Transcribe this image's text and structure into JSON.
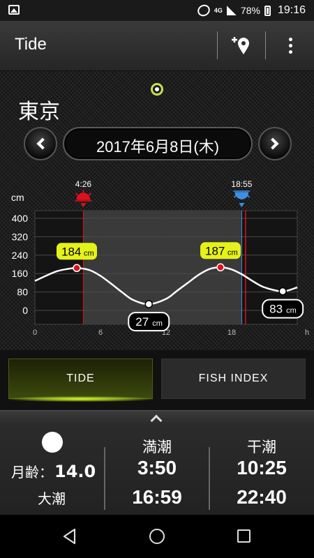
{
  "status_bar": {
    "network": "4G",
    "battery": "78%",
    "time": "19:16"
  },
  "app_bar": {
    "title": "Tide",
    "icons": [
      "add-location-icon",
      "overflow-menu-icon"
    ]
  },
  "location": "東京",
  "date": "2017年6月8日(木)",
  "chart_data": {
    "type": "line",
    "y_unit": "cm",
    "x_unit": "h",
    "xlim": [
      0,
      24
    ],
    "ylim": [
      0,
      400
    ],
    "x_ticks": [
      "0",
      "6",
      "12",
      "18"
    ],
    "y_ticks": [
      "400",
      "320",
      "240",
      "160",
      "80",
      "0"
    ],
    "sunrise": "4:26",
    "sunset": "18:55",
    "sunrise_hour": 4.43,
    "sunset_hour": 18.92,
    "current_time_hour": 19.27,
    "series": [
      {
        "values_x": [
          0,
          1,
          2,
          3,
          3.83,
          5,
          6,
          7,
          8,
          9,
          10.42,
          12,
          13,
          14,
          15,
          16,
          16.98,
          18,
          19,
          20,
          21,
          22.67,
          24
        ],
        "values_y": [
          128,
          150,
          170,
          180,
          184,
          175,
          150,
          115,
          78,
          45,
          27,
          50,
          85,
          120,
          155,
          180,
          187,
          178,
          155,
          125,
          100,
          83,
          100
        ]
      }
    ],
    "annotations": [
      {
        "label": "184",
        "unit": "cm",
        "x": 3.83,
        "y": 184,
        "kind": "high"
      },
      {
        "label": "27",
        "unit": "cm",
        "x": 10.42,
        "y": 27,
        "kind": "low"
      },
      {
        "label": "187",
        "unit": "cm",
        "x": 16.98,
        "y": 187,
        "kind": "high"
      },
      {
        "label": "83",
        "unit": "cm",
        "x": 22.67,
        "y": 83,
        "kind": "low"
      }
    ],
    "colors": {
      "high_badge": "#e5f21a",
      "high_point": "#e0101a",
      "sunrise": "#e0101a",
      "sunset": "#3f8fe0",
      "current_line": "#e0101a",
      "curve": "#ffffff"
    }
  },
  "tabs": [
    {
      "label": "TIDE",
      "active": true
    },
    {
      "label": "FISH INDEX",
      "active": false
    }
  ],
  "info": {
    "moon_age_label": "月齢：",
    "moon_age_value": "14.0",
    "tide_type": "大潮",
    "high_tide": {
      "label": "満潮",
      "times": [
        "3:50",
        "16:59"
      ]
    },
    "low_tide": {
      "label": "干潮",
      "times": [
        "10:25",
        "22:40"
      ]
    }
  }
}
